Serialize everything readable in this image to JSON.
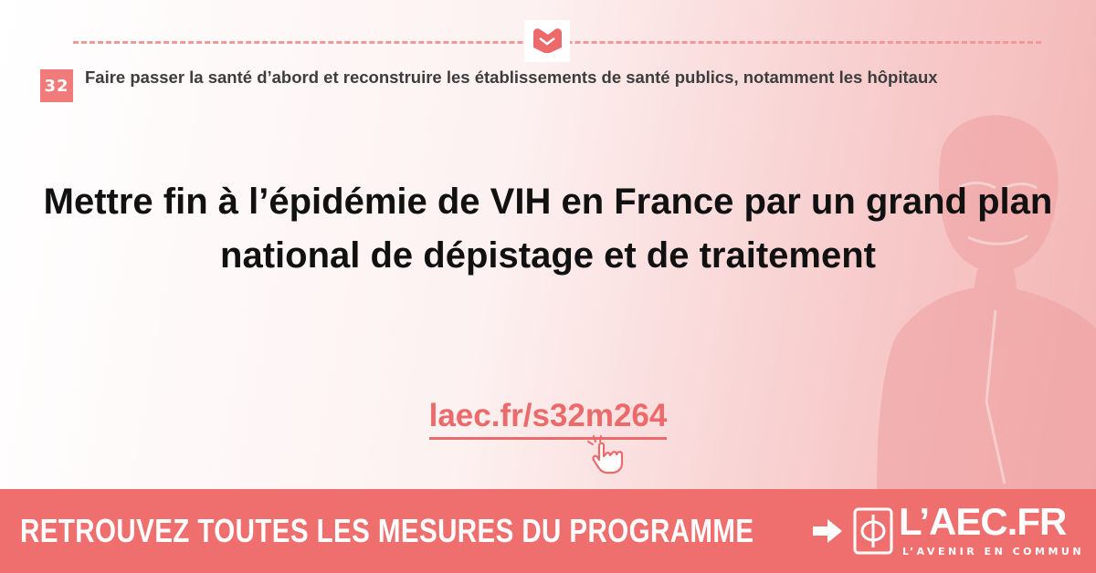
{
  "header": {
    "badge_number": "32",
    "section_title": "Faire passer la santé d’abord et reconstruire les établissements de santé publics, notamment les hôpitaux"
  },
  "main": {
    "title": "Mettre fin à l’épidémie de VIH en France par un grand plan national de dépistage et de traitement",
    "link_text": "laec.fr/s32m264"
  },
  "banner": {
    "cta_text": "RETROUVEZ TOUTES LES MESURES DU PROGRAMME",
    "logo_main": "L’AEC.FR",
    "logo_sub": "L’AVENIR EN COMMUN"
  },
  "colors": {
    "accent": "#ef6f6f",
    "badge": "#f17b7b",
    "link": "#ec6a6a",
    "title": "#111111"
  },
  "icons": [
    "handshake-icon",
    "pointer-hand-icon",
    "arrow-right-icon",
    "phi-logo-icon"
  ]
}
